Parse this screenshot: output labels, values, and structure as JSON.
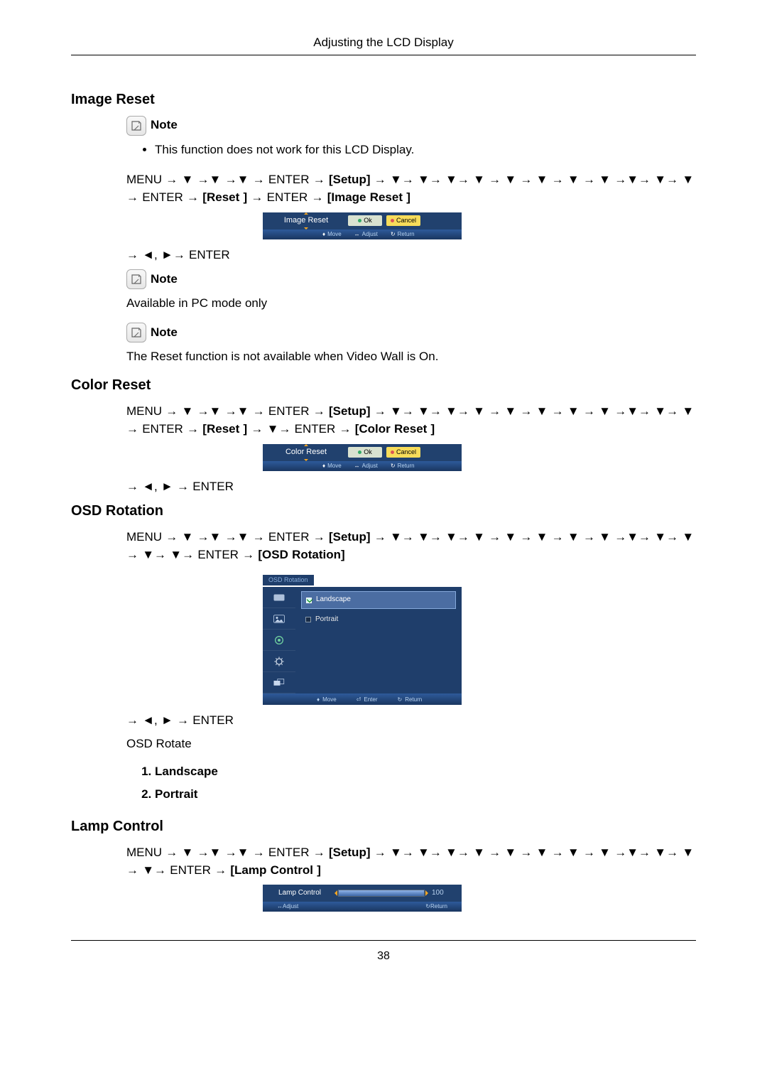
{
  "header": {
    "title": "Adjusting the LCD Display"
  },
  "note_label": "Note",
  "page_number": "38",
  "sections": {
    "image_reset": {
      "heading": "Image Reset",
      "bullet1": "This function does not work for this LCD Display.",
      "path_prefix": "MENU → ▼ →▼ →▼ → ENTER → ",
      "path_setup": "[Setup]",
      "path_mid": " → ▼→ ▼→ ▼→ ▼ → ▼ → ▼ → ▼ → ▼ →▼→ ▼→ ▼ → ENTER → ",
      "path_reset": "[Reset ]",
      "path_end": "→ ENTER → ",
      "path_target": "[Image Reset ]",
      "dialog": {
        "title": "Image Reset",
        "ok": "Ok",
        "cancel": "Cancel",
        "footer_move": "Move",
        "footer_adjust": "Adjust",
        "footer_return": "Return"
      },
      "after_dialog": "→ ◄, ►→ ENTER",
      "note2_text": "Available in PC mode only",
      "pc": "PC",
      "note3_prefix": "The Reset function is not available when ",
      "note3_vw": "Video Wall",
      "note3_mid": " is ",
      "note3_on": "On",
      "note3_suffix": "."
    },
    "color_reset": {
      "heading": "Color Reset",
      "path_prefix": "MENU → ▼ →▼ →▼ → ENTER → ",
      "path_setup": "[Setup]",
      "path_mid": " → ▼→ ▼→ ▼→ ▼ → ▼ → ▼ → ▼ → ▼ →▼→ ▼→ ▼ → ENTER → ",
      "path_reset": "[Reset ]",
      "path_end": "→ ▼→ ENTER → ",
      "path_target": "[Color Reset ]",
      "dialog": {
        "title": "Color Reset",
        "ok": "Ok",
        "cancel": "Cancel",
        "footer_move": "Move",
        "footer_adjust": "Adjust",
        "footer_return": "Return"
      },
      "after_dialog": "→ ◄, ► → ENTER"
    },
    "osd_rotation": {
      "heading": "OSD Rotation",
      "path_prefix": "MENU → ▼ →▼ →▼ → ENTER → ",
      "path_setup": "[Setup]",
      "path_mid": " → ▼→ ▼→ ▼→ ▼ → ▼ → ▼ → ▼ → ▼ →▼→ ▼→ ▼ → ▼→ ▼→ ENTER → ",
      "path_target": "[OSD Rotation]",
      "menu": {
        "tab": "OSD Rotation",
        "opt1": "Landscape",
        "opt2": "Portrait",
        "footer_move": "Move",
        "footer_enter": "Enter",
        "footer_return": "Return"
      },
      "after_dialog": "→ ◄, ► → ENTER",
      "sub_label": "OSD Rotate",
      "list1": "Landscape",
      "list2": "Portrait"
    },
    "lamp_control": {
      "heading": "Lamp Control",
      "path_prefix": "MENU → ▼ →▼ →▼ → ENTER → ",
      "path_setup": "[Setup]",
      "path_mid": " → ▼→ ▼→ ▼→ ▼ → ▼ → ▼ → ▼ → ▼ →▼→ ▼→ ▼ → ▼→ ENTER → ",
      "path_target": "[Lamp Control ]",
      "dialog": {
        "title": "Lamp Control",
        "value": "100",
        "footer_adjust": "Adjust",
        "footer_return": "Return"
      }
    }
  }
}
